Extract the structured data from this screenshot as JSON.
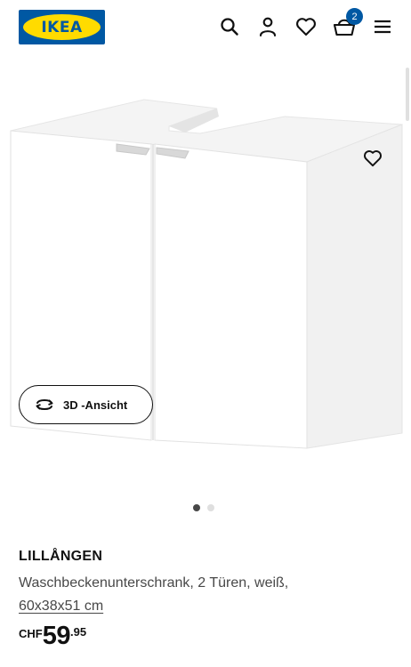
{
  "header": {
    "logo_text": "IKEA",
    "cart_count": "2",
    "icons": [
      "search-icon",
      "account-icon",
      "heart-icon",
      "cart-icon",
      "menu-icon"
    ]
  },
  "gallery": {
    "view3d_label": "3D -Ansicht",
    "dots_total": 2,
    "dots_active": 1
  },
  "product": {
    "name": "LILLÅNGEN",
    "description": "Waschbeckenunterschrank, 2 Türen, weiß,",
    "measurement": "60x38x51 cm",
    "price": {
      "currency": "CHF",
      "integer": "59",
      "decimal": ".95"
    }
  },
  "colors": {
    "ikea_blue": "#0058a3",
    "ikea_yellow": "#ffdb00",
    "text": "#111111",
    "muted_text": "#484848"
  }
}
